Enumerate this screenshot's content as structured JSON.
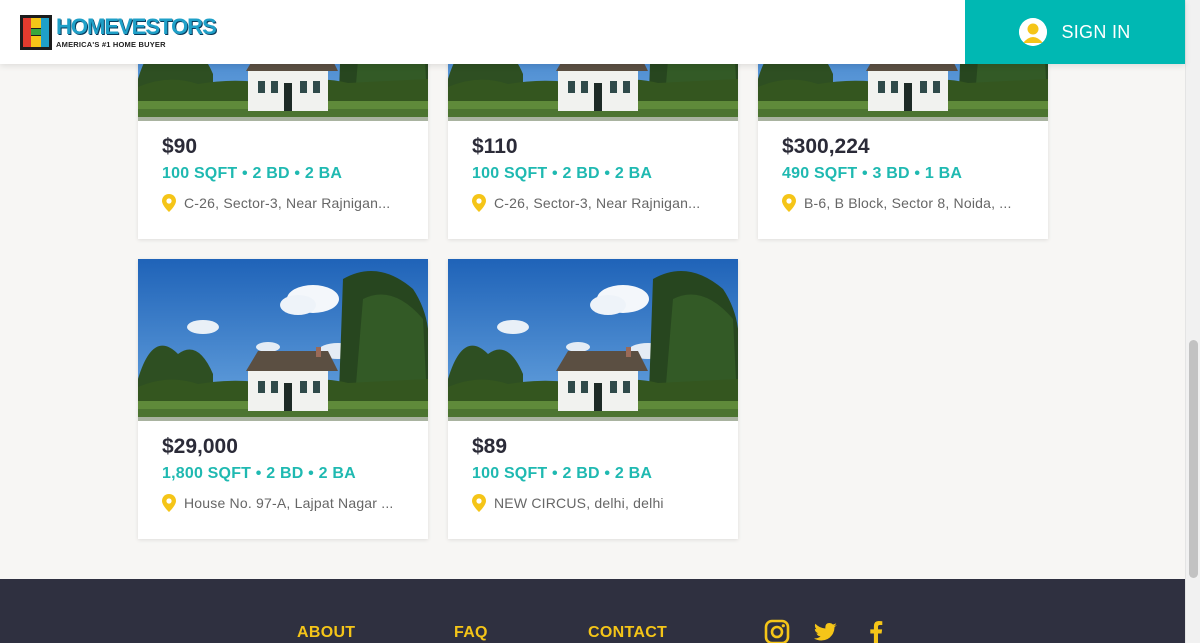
{
  "header": {
    "logo_brand": "HOMEVESTORS",
    "logo_tagline": "AMERICA'S #1 HOME BUYER",
    "signin_label": "SIGN IN"
  },
  "listings": [
    {
      "price": "$90",
      "specs": "100 SQFT • 2 BD • 2 BA",
      "address": "C-26, Sector-3, Near Rajnigan..."
    },
    {
      "price": "$110",
      "specs": "100 SQFT • 2 BD • 2 BA",
      "address": "C-26, Sector-3, Near Rajnigan..."
    },
    {
      "price": "$300,224",
      "specs": "490 SQFT • 3 BD • 1 BA",
      "address": "B-6, B Block, Sector 8, Noida, ..."
    },
    {
      "price": "$29,000",
      "specs": "1,800 SQFT • 2 BD • 2 BA",
      "address": "House No. 97-A, Lajpat Nagar ..."
    },
    {
      "price": "$89",
      "specs": "100 SQFT • 2 BD • 2 BA",
      "address": "NEW CIRCUS, delhi, delhi"
    }
  ],
  "footer": {
    "links": [
      "ABOUT",
      "FAQ",
      "CONTACT"
    ],
    "social": [
      "instagram-icon",
      "twitter-icon",
      "facebook-icon"
    ]
  },
  "colors": {
    "accent_teal": "#00b8b3",
    "footer_bg": "#2f3040",
    "footer_link": "#f5c518",
    "pin": "#f5c518"
  }
}
